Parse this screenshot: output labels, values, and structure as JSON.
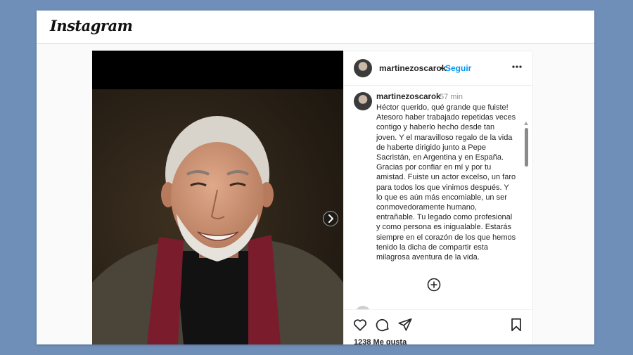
{
  "header": {
    "logo": "Instagram"
  },
  "post": {
    "username": "martinezoscarok",
    "separator": "•",
    "follow_label": "Seguir",
    "caption": {
      "username": "martinezoscarok",
      "time": "57 min",
      "text": "Héctor querido, qué grande que fuiste! Atesoro haber trabajado repetidas veces contigo y haberlo hecho desde tan joven. Y el maravilloso regalo de la vida de haberte dirigido junto a Pepe Sacristán, en Argentina y en España. Gracias por confiar en mí y por tu amistad. Fuiste un actor excelso, un faro para todos los que vinimos después. Y lo que es aún más encomiable, un ser conmovedoramente humano, entrañable. Tu legado como profesional y como persona es inigualable. Estarás siempre en el corazón de los que hemos tenido la dicha de compartir esta milagrosa aventura de la vida."
    },
    "likes_text": "1238 Me gusta"
  },
  "icons": {
    "more": "more-options-icon",
    "next": "chevron-right-icon",
    "add": "plus-circle-icon",
    "like": "heart-icon",
    "comment": "comment-icon",
    "share": "paper-plane-icon",
    "save": "bookmark-icon"
  },
  "colors": {
    "page_background": "#6f8fb8",
    "follow_link": "#0095f6",
    "muted_text": "#8e8e8e",
    "scarf": "#7a1c2c"
  }
}
